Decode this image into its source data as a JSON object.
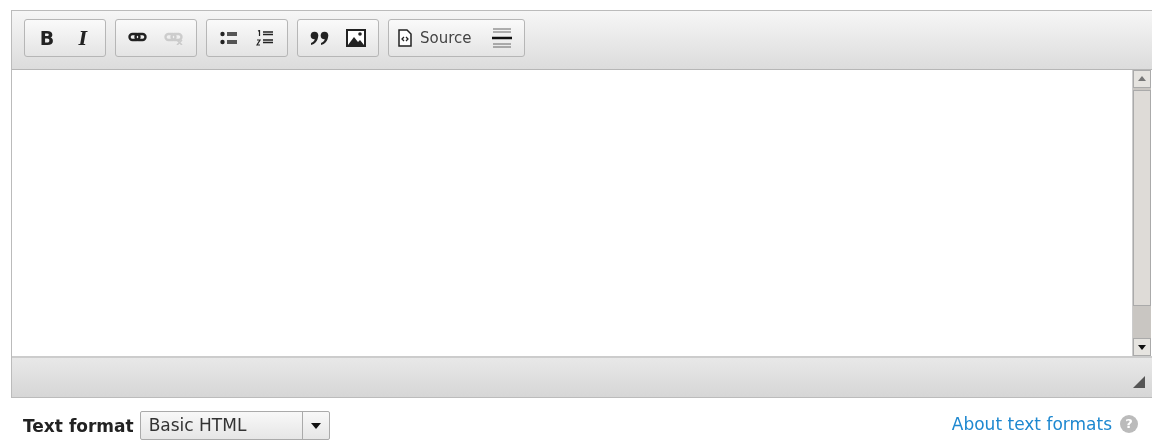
{
  "toolbar": {
    "groups": [
      {
        "buttons": [
          {
            "kind": "bold",
            "label": "B",
            "disabled": false
          },
          {
            "kind": "italic",
            "label": "I",
            "disabled": false
          }
        ]
      },
      {
        "buttons": [
          {
            "kind": "link",
            "disabled": false
          },
          {
            "kind": "unlink",
            "disabled": true
          }
        ]
      },
      {
        "buttons": [
          {
            "kind": "bullets",
            "disabled": false
          },
          {
            "kind": "numbers",
            "disabled": false
          }
        ]
      },
      {
        "buttons": [
          {
            "kind": "quote",
            "disabled": false
          },
          {
            "kind": "image",
            "disabled": false
          }
        ]
      },
      {
        "buttons": [
          {
            "kind": "source",
            "label": "Source",
            "disabled": false
          },
          {
            "kind": "rule",
            "disabled": false
          }
        ]
      }
    ]
  },
  "footer": {
    "label": "Text format",
    "select": {
      "value": "Basic HTML"
    },
    "help_link": "About text formats",
    "help_icon": "?"
  }
}
